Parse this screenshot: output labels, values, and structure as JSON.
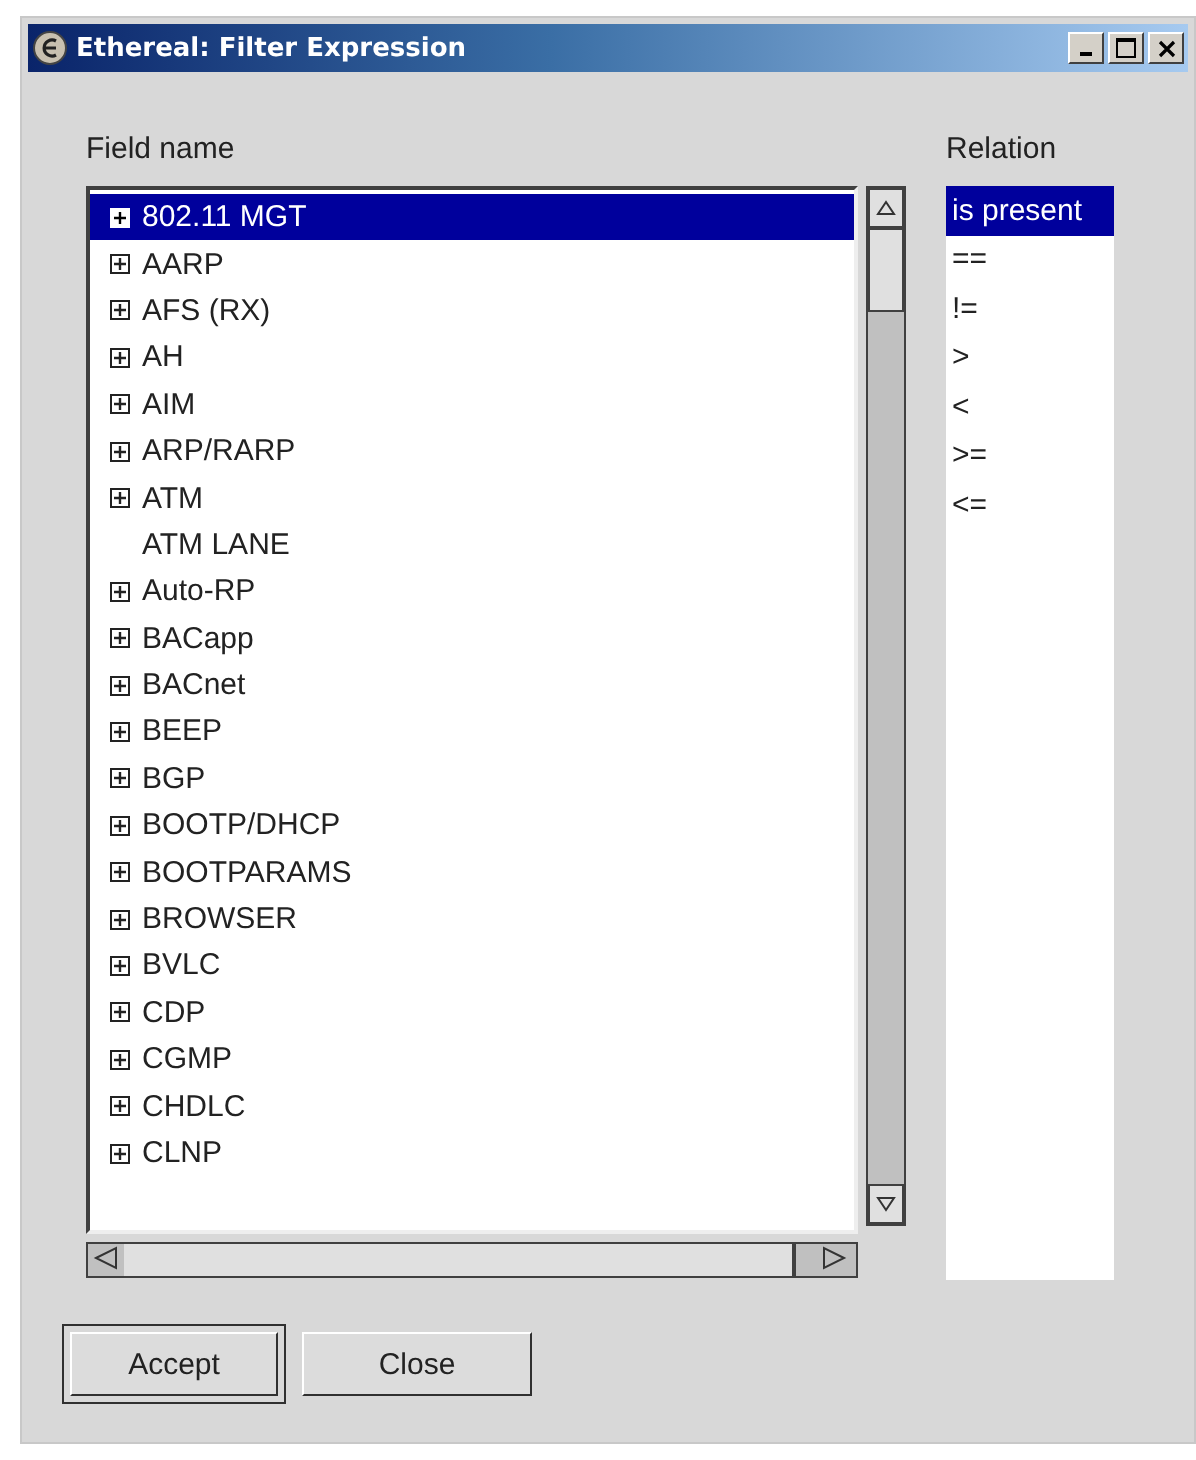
{
  "window": {
    "title": "Ethereal: Filter Expression"
  },
  "field_name": {
    "label": "Field name",
    "items": [
      {
        "label": "802.11 MGT",
        "expandable": true,
        "selected": true
      },
      {
        "label": "AARP",
        "expandable": true,
        "selected": false
      },
      {
        "label": "AFS (RX)",
        "expandable": true,
        "selected": false
      },
      {
        "label": "AH",
        "expandable": true,
        "selected": false
      },
      {
        "label": "AIM",
        "expandable": true,
        "selected": false
      },
      {
        "label": "ARP/RARP",
        "expandable": true,
        "selected": false
      },
      {
        "label": "ATM",
        "expandable": true,
        "selected": false
      },
      {
        "label": "ATM LANE",
        "expandable": false,
        "selected": false
      },
      {
        "label": "Auto-RP",
        "expandable": true,
        "selected": false
      },
      {
        "label": "BACapp",
        "expandable": true,
        "selected": false
      },
      {
        "label": "BACnet",
        "expandable": true,
        "selected": false
      },
      {
        "label": "BEEP",
        "expandable": true,
        "selected": false
      },
      {
        "label": "BGP",
        "expandable": true,
        "selected": false
      },
      {
        "label": "BOOTP/DHCP",
        "expandable": true,
        "selected": false
      },
      {
        "label": "BOOTPARAMS",
        "expandable": true,
        "selected": false
      },
      {
        "label": "BROWSER",
        "expandable": true,
        "selected": false
      },
      {
        "label": "BVLC",
        "expandable": true,
        "selected": false
      },
      {
        "label": "CDP",
        "expandable": true,
        "selected": false
      },
      {
        "label": "CGMP",
        "expandable": true,
        "selected": false
      },
      {
        "label": "CHDLC",
        "expandable": true,
        "selected": false
      },
      {
        "label": "CLNP",
        "expandable": true,
        "selected": false
      }
    ]
  },
  "relation": {
    "label": "Relation",
    "items": [
      {
        "label": "is present",
        "selected": true
      },
      {
        "label": "==",
        "selected": false
      },
      {
        "label": "!=",
        "selected": false
      },
      {
        "label": ">",
        "selected": false
      },
      {
        "label": "<",
        "selected": false
      },
      {
        "label": ">=",
        "selected": false
      },
      {
        "label": "<=",
        "selected": false
      }
    ]
  },
  "buttons": [
    {
      "label": "Accept",
      "default": true
    },
    {
      "label": "Close",
      "default": false
    }
  ]
}
